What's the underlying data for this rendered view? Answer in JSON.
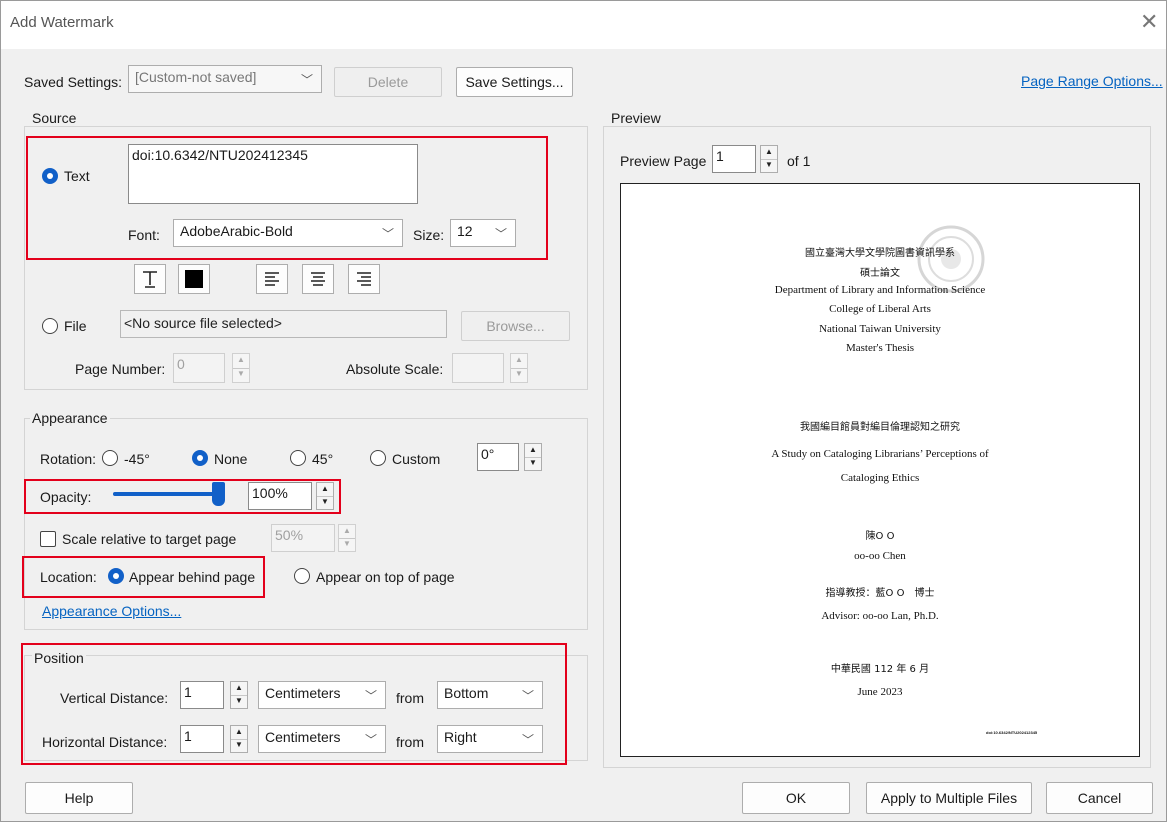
{
  "window": {
    "title": "Add Watermark",
    "close_glyph": "✕"
  },
  "saved_settings": {
    "label": "Saved Settings:",
    "value": "[Custom-not saved]",
    "delete_label": "Delete",
    "save_label": "Save Settings..."
  },
  "page_range_link": "Page Range Options...",
  "source": {
    "title": "Source",
    "text_option": "Text",
    "text_value": "doi:10.6342/NTU202412345",
    "font_label": "Font:",
    "font_value": "AdobeArabic-Bold",
    "size_label": "Size:",
    "size_value": "12",
    "file_option": "File",
    "file_value": "<No source file selected>",
    "browse_label": "Browse...",
    "page_number_label": "Page Number:",
    "page_number_value": "0",
    "absolute_scale_label": "Absolute Scale:",
    "absolute_scale_value": "",
    "text_color": "#000000"
  },
  "appearance": {
    "title": "Appearance",
    "rotation_label": "Rotation:",
    "rot_m45": "-45°",
    "rot_none": "None",
    "rot_45": "45°",
    "rot_custom": "Custom",
    "custom_value": "0°",
    "opacity_label": "Opacity:",
    "opacity_value": "100%",
    "opacity_fraction": 1.0,
    "scale_label": "Scale relative to target page",
    "scale_value": "50%",
    "location_label": "Location:",
    "behind_label": "Appear behind page",
    "on_top_label": "Appear on top of page",
    "options_link": "Appearance Options..."
  },
  "position": {
    "title": "Position",
    "vertical_label": "Vertical Distance:",
    "vertical_value": "1",
    "vertical_unit": "Centimeters",
    "vertical_from_label": "from",
    "vertical_from": "Bottom",
    "horizontal_label": "Horizontal Distance:",
    "horizontal_value": "1",
    "horizontal_unit": "Centimeters",
    "horizontal_from_label": "from",
    "horizontal_from": "Right"
  },
  "preview": {
    "title": "Preview",
    "page_label": "Preview Page",
    "page_value": "1",
    "of_label": "of 1",
    "doc": {
      "line1": "國立臺灣大學文學院圖書資訊學系",
      "line2": "碩士論文",
      "line3": "Department of Library and Information Science",
      "line4": "College of Liberal Arts",
      "line5": "National Taiwan University",
      "line6": "Master's Thesis",
      "line7": "我國編目館員對編目倫理認知之研究",
      "line8": "A Study on Cataloging Librarians’ Perceptions of",
      "line9": "Cataloging Ethics",
      "line10": "陳O O",
      "line11": "oo-oo Chen",
      "line12": "指導教授：藍O O　博士",
      "line13": "Advisor: oo-oo Lan, Ph.D.",
      "line14": "中華民國 112 年 6 月",
      "line15": "June 2023",
      "watermark": "doi:10.6342/NTU202412345"
    }
  },
  "footer": {
    "help": "Help",
    "ok": "OK",
    "apply_multiple": "Apply to Multiple Files",
    "cancel": "Cancel"
  },
  "colors": {
    "accent": "#1160c8",
    "highlight": "#e3001b",
    "link": "#0563c1"
  }
}
